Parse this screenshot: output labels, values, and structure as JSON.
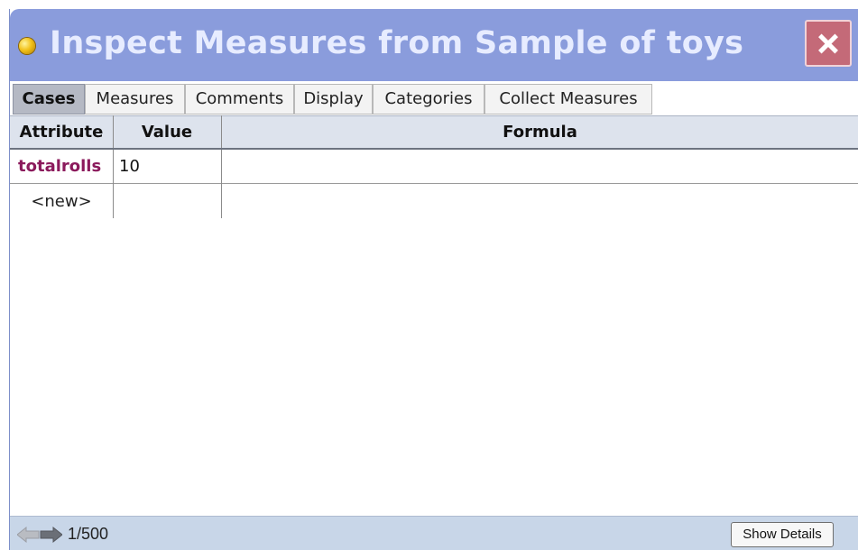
{
  "window": {
    "title": "Inspect Measures from Sample of toys",
    "close_icon": "close-icon",
    "title_icon": "yellow-dot-icon"
  },
  "tabs": [
    {
      "label": "Cases",
      "active": true
    },
    {
      "label": "Measures",
      "active": false
    },
    {
      "label": "Comments",
      "active": false
    },
    {
      "label": "Display",
      "active": false
    },
    {
      "label": "Categories",
      "active": false
    },
    {
      "label": "Collect Measures",
      "active": false
    }
  ],
  "table": {
    "columns": [
      "Attribute",
      "Value",
      "Formula"
    ],
    "rows": [
      {
        "attribute": "totalrolls",
        "value": "10",
        "formula": ""
      }
    ],
    "new_row_label": "<new>"
  },
  "status": {
    "counter": "1/500",
    "show_details_label": "Show Details",
    "nav_icons": [
      "arrow-left-icon",
      "arrow-right-icon"
    ]
  },
  "colors": {
    "titlebar": "#8a9cdc",
    "close_button": "#c46a78",
    "attribute_name": "#8b1a5c",
    "statusbar": "#c8d6e8"
  }
}
